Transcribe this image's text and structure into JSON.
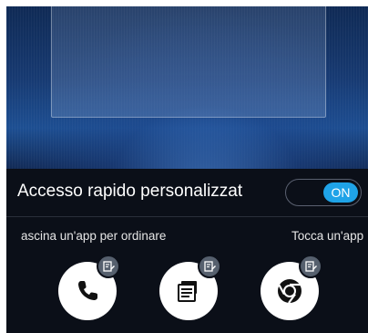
{
  "quick_access": {
    "title": "Accesso rapido personalizzat",
    "switch_label": "ON",
    "switch_state": "on",
    "accent_color": "#1fa3e8"
  },
  "hints": {
    "left": "ascina un'app per ordinare",
    "right": "Tocca un'app"
  },
  "apps": [
    {
      "name": "phone",
      "icon": "phone-icon"
    },
    {
      "name": "messages",
      "icon": "messages-icon"
    },
    {
      "name": "chrome",
      "icon": "chrome-icon"
    }
  ]
}
